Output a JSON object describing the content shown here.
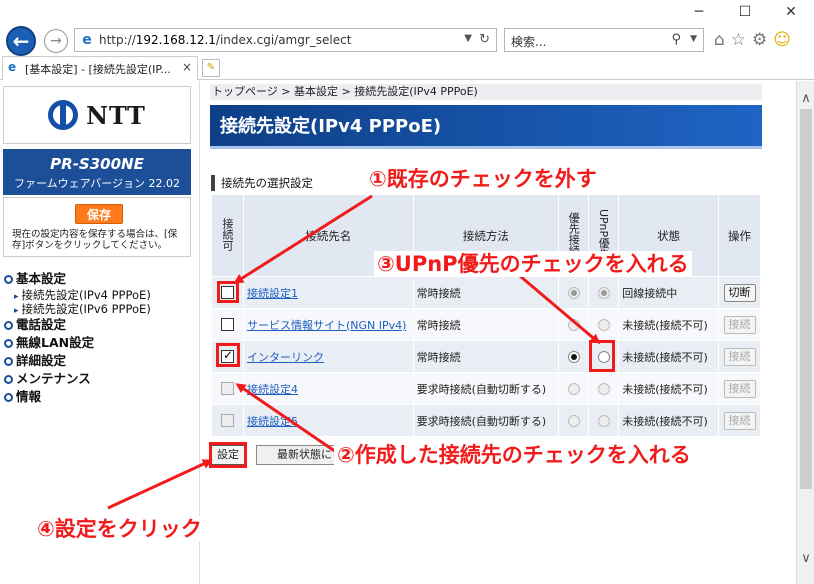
{
  "browser": {
    "window_controls": {
      "minimize": "─",
      "maximize": "☐",
      "close": "✕"
    },
    "back_glyph": "←",
    "forward_glyph": "→",
    "address": {
      "prefix": "http://",
      "host": "192.168.12.1",
      "path": "/index.cgi/amgr_select"
    },
    "search_placeholder": "検索...",
    "tab_title": "[基本設定] - [接続先設定(IP...",
    "toolbar_icons": [
      "home-icon",
      "star-icon",
      "gear-icon",
      "smiley-icon"
    ]
  },
  "sidebar": {
    "logo_text": "NTT",
    "model": "PR-S300NE",
    "firmware": "ファームウェアバージョン 22.02",
    "save_label": "保存",
    "save_note": "現在の設定内容を保存する場合は、[保存]ボタンをクリックしてください。",
    "menu": [
      {
        "label": "基本設定",
        "subs": [
          "接続先設定(IPv4 PPPoE)",
          "接続先設定(IPv6 PPPoE)"
        ]
      },
      {
        "label": "電話設定",
        "subs": []
      },
      {
        "label": "無線LAN設定",
        "subs": []
      },
      {
        "label": "詳細設定",
        "subs": []
      },
      {
        "label": "メンテナンス",
        "subs": []
      },
      {
        "label": "情報",
        "subs": []
      }
    ]
  },
  "main": {
    "breadcrumb": "トップページ > 基本設定 > 接続先設定(IPv4 PPPoE)",
    "title": "接続先設定(IPv4 PPPoE)",
    "section": "接続先の選択設定",
    "headers": {
      "enable": "接続可",
      "name": "接続先名",
      "method": "接続方法",
      "priority": "優先接続",
      "upnp": "UPnP優先",
      "status": "状態",
      "action": "操作"
    },
    "rows": [
      {
        "enabled": false,
        "enable_disabled": false,
        "name": "接続設定1",
        "name_link": true,
        "method": "常時接続",
        "priority": true,
        "priority_disabled": true,
        "upnp": true,
        "upnp_disabled": true,
        "status": "回線接続中",
        "action": "切断",
        "action_disabled": false
      },
      {
        "enabled": false,
        "enable_disabled": false,
        "name": "サービス情報サイト(NGN IPv4)",
        "name_link": true,
        "method": "常時接続",
        "priority": false,
        "priority_disabled": true,
        "upnp": false,
        "upnp_disabled": true,
        "status": "未接続(接続不可)",
        "action": "接続",
        "action_disabled": true
      },
      {
        "enabled": true,
        "enable_disabled": false,
        "name": "インターリンク",
        "name_link": true,
        "method": "常時接続",
        "priority": true,
        "priority_disabled": false,
        "upnp": false,
        "upnp_disabled": false,
        "status": "未接続(接続不可)",
        "action": "接続",
        "action_disabled": true
      },
      {
        "enabled": false,
        "enable_disabled": true,
        "name": "接続設定4",
        "name_link": true,
        "method": "要求時接続(自動切断する)",
        "priority": false,
        "priority_disabled": true,
        "upnp": false,
        "upnp_disabled": true,
        "status": "未接続(接続不可)",
        "action": "接続",
        "action_disabled": true
      },
      {
        "enabled": false,
        "enable_disabled": true,
        "name": "接続設定5",
        "name_link": true,
        "method": "要求時接続(自動切断する)",
        "priority": false,
        "priority_disabled": true,
        "upnp": false,
        "upnp_disabled": true,
        "status": "未接続(接続不可)",
        "action": "接続",
        "action_disabled": true
      }
    ],
    "set_button": "設定",
    "refresh_button": "最新状態に"
  },
  "annotations": {
    "step1": "①既存のチェックを外す",
    "step2": "②作成した接続先のチェックを入れる",
    "step3": "③UPnP優先のチェックを入れる",
    "step4": "④設定をクリック",
    "color": "#f21b1b"
  }
}
